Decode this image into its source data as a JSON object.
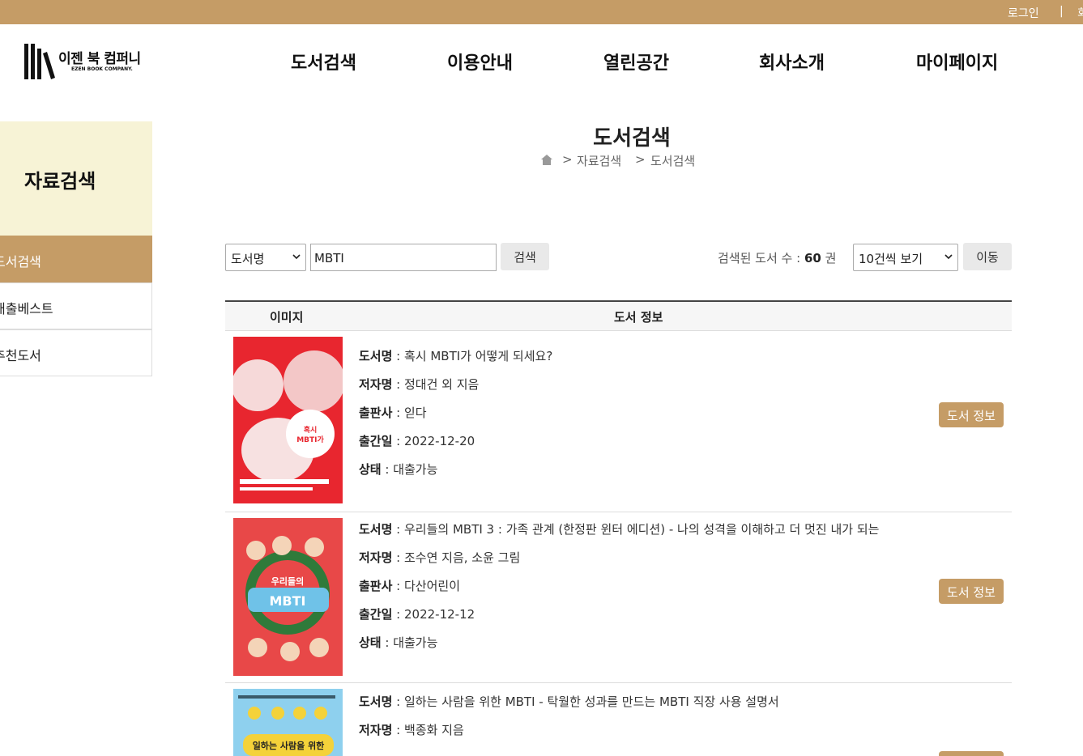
{
  "topbar": {
    "login": "로그인",
    "separator": "|",
    "extra": "회"
  },
  "logo": {
    "name": "이젠 북 컴퍼니",
    "sub": "EZEN BOOK COMPANY."
  },
  "nav": [
    "도서검색",
    "이용안내",
    "열린공간",
    "회사소개",
    "마이페이지"
  ],
  "sidebar": {
    "title": "자료검색",
    "items": [
      {
        "label": "도서검색",
        "active": true
      },
      {
        "label": "대출베스트",
        "active": false
      },
      {
        "label": "추천도서",
        "active": false
      }
    ]
  },
  "page": {
    "title": "도서검색",
    "breadcrumb": [
      ">",
      "자료검색",
      ">",
      "도서검색"
    ]
  },
  "search": {
    "field_select": "도서명",
    "query": "MBTI",
    "button": "검색",
    "count_label": "검색된 도서 수 : ",
    "count_value": "60",
    "count_unit": " 권",
    "per_page_select": "10건씩 보기",
    "move_button": "이동"
  },
  "table": {
    "headers": [
      "이미지",
      "도서 정보"
    ],
    "field_labels": {
      "title": "도서명",
      "author": "저자명",
      "publisher": "출판사",
      "date": "출간일",
      "status": "상태"
    },
    "detail_button": "도서 정보",
    "rows": [
      {
        "title": "혹시 MBTI가 어떻게 되세요?",
        "author": "정대건 외 지음",
        "publisher": "읻다",
        "date": "2022-12-20",
        "status": "대출가능",
        "cover": {
          "bg": "#e8262f",
          "text": "혹시 MBTI가 어떻게 되세요?"
        }
      },
      {
        "title": "우리들의 MBTI 3 : 가족 관계 (한정판 윈터 에디션) - 나의 성격을 이해하고 더 멋진 내가 되는",
        "author": "조수연 지음, 소윤 그림",
        "publisher": "다산어린이",
        "date": "2022-12-12",
        "status": "대출가능",
        "cover": {
          "bg": "#e84848",
          "text": "우리들의 MBTI"
        }
      },
      {
        "title": "일하는 사람을 위한 MBTI - 탁월한 성과를 만드는 MBTI 직장 사용 설명서",
        "author": "백종화 지음",
        "cover": {
          "bg": "#8ed0ee",
          "text": "일하는 사람을 위한"
        }
      }
    ]
  },
  "colors": {
    "brand": "#c59c66",
    "sidebar_bg": "#f7f3d6"
  }
}
